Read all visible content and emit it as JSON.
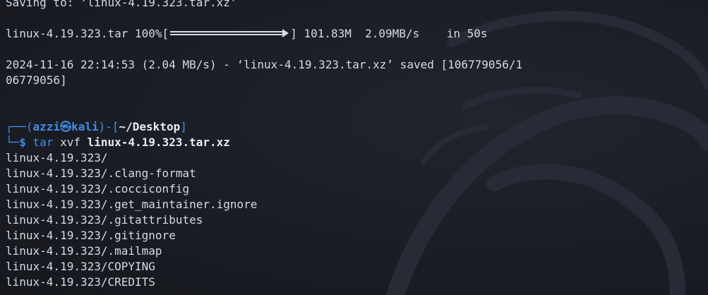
{
  "wget": {
    "saving_line": "Saving to: ‘linux-4.19.323.tar.xz’",
    "progress": {
      "filename": "linux-4.19.323.tar 100%[",
      "fraction": 1.0,
      "stats": "] 101.83M  2.09MB/s    in 50s"
    },
    "saved_line_1": "2024-11-16 22:14:53 (2.04 MB/s) - ‘linux-4.19.323.tar.xz’ saved [106779056/1",
    "saved_line_2": "06779056]"
  },
  "prompt": {
    "corner_top": "┌──(",
    "user": "azzi",
    "at_symbol": "㉿",
    "host": "kali",
    "mid": ")-[",
    "dir": "~/Desktop",
    "close": "]",
    "corner_bottom": "└─",
    "dollar": "$",
    "command": "tar",
    "args": "xvf",
    "target": "linux-4.19.323.tar.xz"
  },
  "output": [
    "linux-4.19.323/",
    "linux-4.19.323/.clang-format",
    "linux-4.19.323/.cocciconfig",
    "linux-4.19.323/.get_maintainer.ignore",
    "linux-4.19.323/.gitattributes",
    "linux-4.19.323/.gitignore",
    "linux-4.19.323/.mailmap",
    "linux-4.19.323/COPYING",
    "linux-4.19.323/CREDITS"
  ],
  "colors": {
    "background": "#1b1e25",
    "text": "#d7dae0",
    "prompt_blue": "#3f8de6"
  },
  "icons": {
    "background_watermark": "kali-dragon-icon"
  }
}
